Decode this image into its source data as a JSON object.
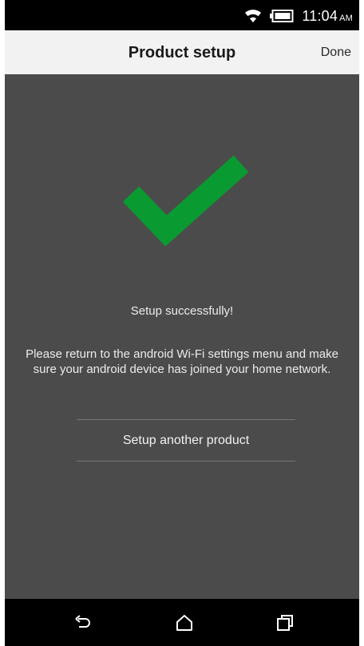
{
  "status_bar": {
    "time": "11:04",
    "ampm": "AM",
    "icons": [
      "wifi-icon",
      "battery-icon"
    ]
  },
  "app_bar": {
    "title": "Product setup",
    "done_label": "Done"
  },
  "main": {
    "status_icon": "check-icon",
    "success_message": "Setup successfully!",
    "instruction": "Please return to the android Wi-Fi settings menu and make sure your android device has joined your home network.",
    "setup_another_label": "Setup another product"
  },
  "nav_bar": {
    "icons": [
      "back-icon",
      "home-icon",
      "recents-icon"
    ]
  },
  "colors": {
    "content_bg": "#4b4b4b",
    "check_green": "#0a9a32",
    "app_bar_bg": "#f2f2f2"
  }
}
